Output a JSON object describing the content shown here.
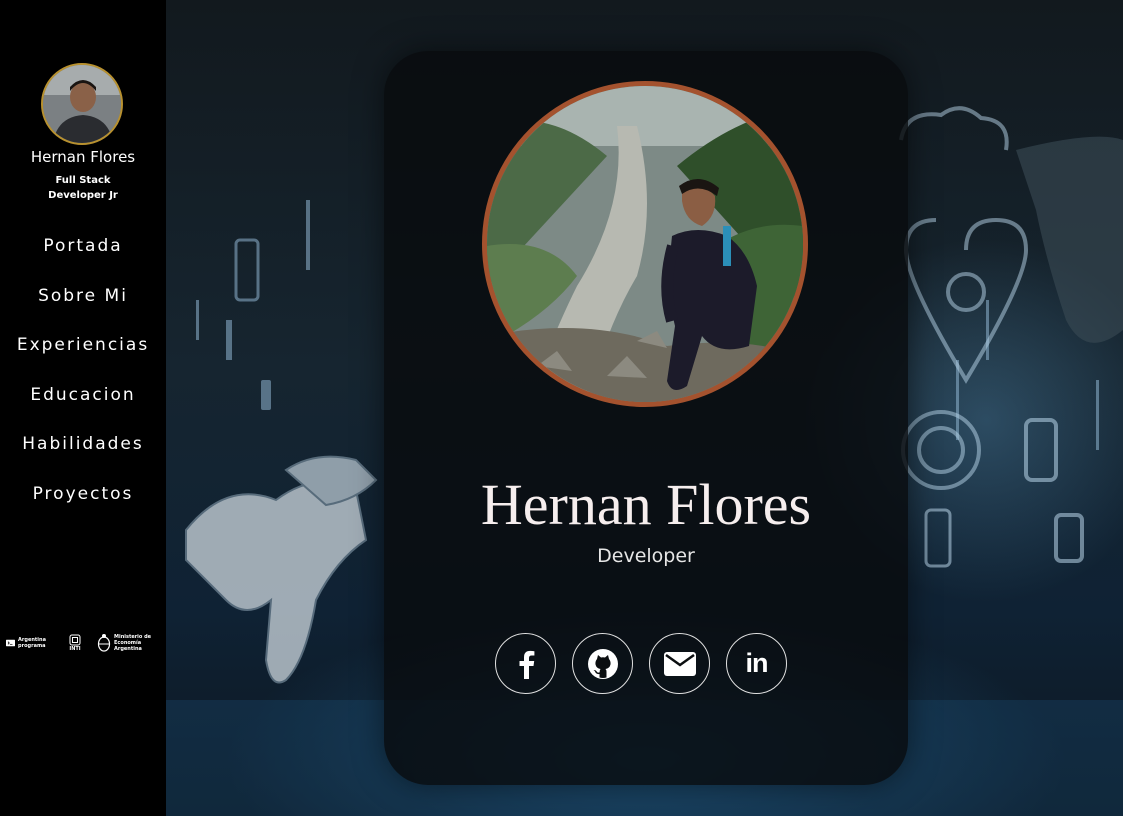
{
  "sidebar": {
    "name": "Hernan Flores",
    "role": "Full Stack Developer Jr",
    "nav": [
      {
        "label": "Portada"
      },
      {
        "label": "Sobre Mi"
      },
      {
        "label": "Experiencias"
      },
      {
        "label": "Educacion"
      },
      {
        "label": "Habilidades"
      },
      {
        "label": "Proyectos"
      }
    ],
    "logos": {
      "argentina_programa": "Argentina programa",
      "inti": "INTI",
      "ministerio": "Ministerio de Economía Argentina"
    }
  },
  "card": {
    "name": "Hernan Flores",
    "role": "Developer",
    "social": [
      {
        "icon": "facebook-icon"
      },
      {
        "icon": "github-icon"
      },
      {
        "icon": "envelope-icon"
      },
      {
        "icon": "linkedin-icon",
        "text": "in"
      }
    ]
  },
  "colors": {
    "avatar_border": "#b8912f",
    "photo_border": "#a4522e",
    "name_text": "#f6eeee",
    "sidebar_bg": "#000000"
  }
}
